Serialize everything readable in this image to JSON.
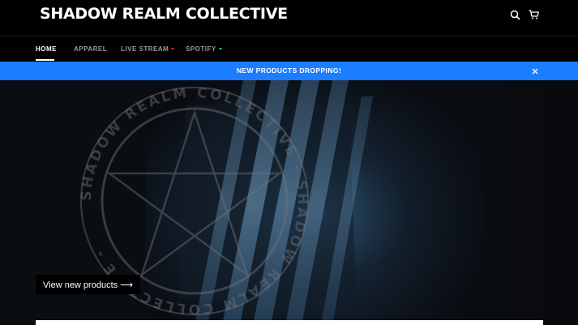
{
  "header": {
    "brand": "SHADOW REALM COLLECTIVE",
    "search_icon": "search-icon",
    "cart_icon": "cart-icon"
  },
  "nav": {
    "items": [
      {
        "label": "HOME",
        "active": true
      },
      {
        "label": "APPAREL",
        "active": false
      },
      {
        "label": "LIVE STREAM",
        "active": false,
        "dropdown": true,
        "caret_color": "#e0262f"
      },
      {
        "label": "SPOTIFY",
        "active": false,
        "dropdown": true,
        "caret_color": "#1ed760"
      }
    ]
  },
  "announcement": {
    "text": "NEW PRODUCTS DROPPING!",
    "background": "#1b7dff",
    "close_icon": "close-icon"
  },
  "hero": {
    "seal_text": "SHADOW REALM COLLECTIVE - SHADOW REALM COLLECTIVE -",
    "cta_label": "View new products ⟶"
  },
  "colors": {
    "accent": "#1b7dff",
    "background": "#000000"
  }
}
